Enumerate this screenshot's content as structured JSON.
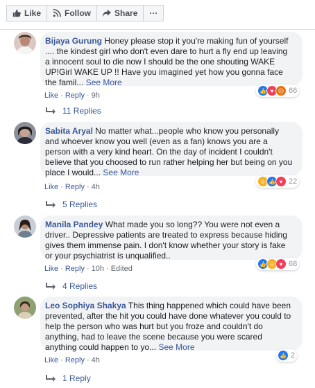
{
  "toolbar": {
    "like_label": "Like",
    "follow_label": "Follow",
    "share_label": "Share",
    "more_label": "···"
  },
  "comments": [
    {
      "author": "Bijaya Gurung",
      "text": "Honey please stop it you're making fun of yourself .... the kindest girl who don't even dare to hurt a fly end up leaving a innocent soul to die now I should be the one shouting WAKE UP!Girl WAKE UP !! Have you imagined yet how you gonna face the famil...",
      "see_more": "See More",
      "like": "Like",
      "reply": "Reply",
      "time": "9h",
      "edited": "",
      "reaction_count": "66",
      "reactions": [
        "like",
        "love",
        "angry"
      ],
      "replies": "11 Replies"
    },
    {
      "author": "Sabita Aryal",
      "text": "No matter what...people who know you personally and whoever know you well (even as a fan) knows you are a person with a very kind heart. On the day of incident I couldn't believe that you choosed to run rather helping her but being on you place I would...",
      "see_more": "See More",
      "like": "Like",
      "reply": "Reply",
      "time": "4h",
      "edited": "",
      "reaction_count": "22",
      "reactions": [
        "haha",
        "like",
        "love"
      ],
      "replies": "5 Replies"
    },
    {
      "author": "Manila Pandey",
      "text": "What made you so long?? You were not even a driver.. Depressive patients are treated to express because hiding gives them immense pain. I don't know whether your story is fake or your psychiatrist is unqualified..",
      "see_more": "",
      "like": "Like",
      "reply": "Reply",
      "time": "10h",
      "edited": "Edited",
      "reaction_count": "68",
      "reactions": [
        "like",
        "haha",
        "love"
      ],
      "replies": "4 Replies"
    },
    {
      "author": "Leo Sophiya Shakya",
      "text": "This thing happened which could have been prevented, after the hit you could have done whatever you could to help the person who was hurt but you froze and couldn't do anything, had to leave the scene because you were scared anything could happen to yo...",
      "see_more": "See More",
      "like": "Like",
      "reply": "Reply",
      "time": "4h",
      "edited": "",
      "reaction_count": "2",
      "reactions": [
        "like"
      ],
      "replies": "1 Reply"
    }
  ],
  "colors": {
    "link": "#385898",
    "bubble": "#f2f3f5",
    "like": "#2078f4",
    "love": "#f33e58",
    "haha": "#f7b125",
    "angry": "#e9710f"
  }
}
